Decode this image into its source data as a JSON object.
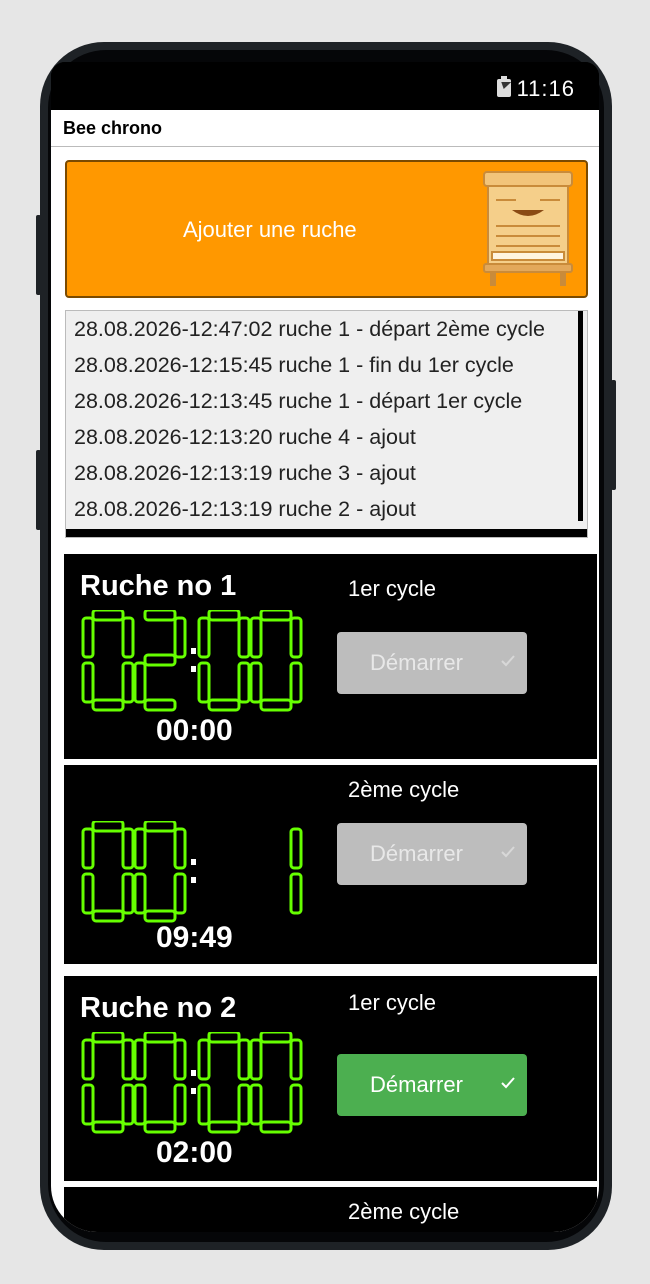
{
  "status": {
    "time": "11:16",
    "battery_icon": "battery-charging-icon"
  },
  "app": {
    "title": "Bee chrono"
  },
  "add_button": {
    "label": "Ajouter une ruche",
    "icon": "beehive-icon"
  },
  "log": {
    "lines": [
      "28.08.2026-12:47:02 ruche 1 - départ 2ème cycle",
      "28.08.2026-12:15:45 ruche 1 - fin du 1er cycle",
      "28.08.2026-12:13:45 ruche 1 - départ 1er cycle",
      "28.08.2026-12:13:20 ruche 4 - ajout",
      "28.08.2026-12:13:19 ruche 3 - ajout",
      "28.08.2026-12:13:19 ruche 2 - ajout"
    ]
  },
  "hives": [
    {
      "name": "Ruche no 1",
      "cycles": [
        {
          "label": "1er cycle",
          "display": "02:00",
          "remaining": "00:00",
          "button_label": "Démarrer",
          "button_enabled": false
        },
        {
          "label": "2ème cycle",
          "display": "00: 11",
          "remaining": "09:49",
          "button_label": "Démarrer",
          "button_enabled": false
        }
      ]
    },
    {
      "name": "Ruche no 2",
      "cycles": [
        {
          "label": "1er cycle",
          "display": "00:00",
          "remaining": "02:00",
          "button_label": "Démarrer",
          "button_enabled": true
        },
        {
          "label": "2ème cycle"
        }
      ]
    }
  ],
  "colors": {
    "accent_orange": "#ff9800",
    "segment_green": "#66ff00",
    "button_green": "#4caf50",
    "button_disabled": "#bdbdbd"
  }
}
